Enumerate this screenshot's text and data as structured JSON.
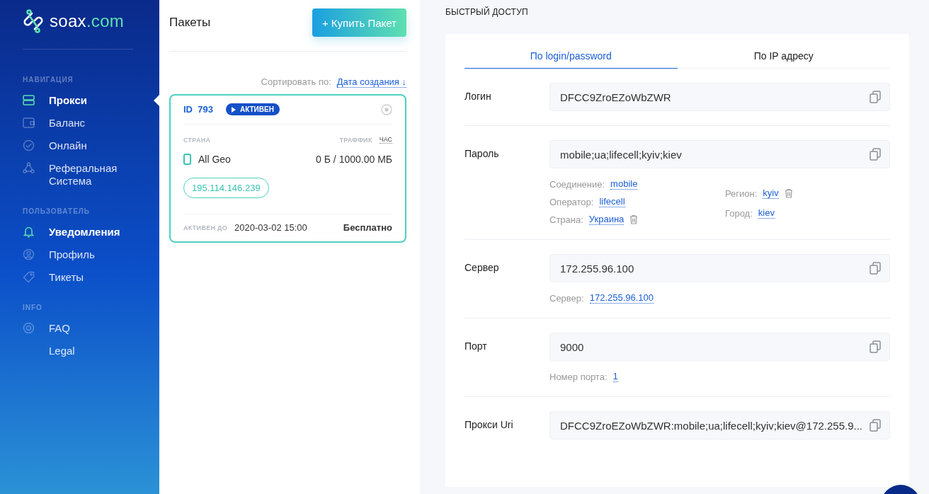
{
  "logo": {
    "name": "soax",
    "tld": ".com"
  },
  "sidebar": {
    "sections": [
      {
        "title": "НАВИГАЦИЯ",
        "items": [
          {
            "label": "Прокси",
            "selected": true,
            "highlighted": true
          },
          {
            "label": "Баланс",
            "selected": false,
            "highlighted": false
          },
          {
            "label": "Онлайн",
            "selected": false,
            "highlighted": false
          },
          {
            "label": "Реферальная Система",
            "selected": false,
            "highlighted": false
          }
        ]
      },
      {
        "title": "ПОЛЬЗОВАТЕЛЬ",
        "items": [
          {
            "label": "Уведомления",
            "selected": false,
            "highlighted": true
          },
          {
            "label": "Профиль",
            "selected": false,
            "highlighted": false
          },
          {
            "label": "Тикеты",
            "selected": false,
            "highlighted": false
          }
        ]
      },
      {
        "title": "INFO",
        "items": [
          {
            "label": "FAQ",
            "selected": false,
            "highlighted": false
          },
          {
            "label": "Legal",
            "selected": false,
            "highlighted": false
          }
        ]
      }
    ]
  },
  "packages": {
    "title": "Пакеты",
    "buy_button": "+ Купить Пакет",
    "sort_label": "Сортировать по:",
    "sort_value": "Дата создания ↓",
    "cards": [
      {
        "id_label": "ID",
        "id": "793",
        "status": "АКТИВЕН",
        "country_label": "СТРАНА",
        "traffic_label": "ТРАФФИК",
        "traffic_unit": "ЧАС",
        "country": "All Geo",
        "traffic": "0 Б / 1000.00 МБ",
        "ip": "195.114.146.239",
        "active_until_label": "АКТИВЕН ДО",
        "active_until": "2020-03-02 15:00",
        "price": "Бесплатно",
        "selected": true
      }
    ]
  },
  "quick_access": {
    "title": "БЫСТРЫЙ ДОСТУП",
    "tabs": [
      {
        "label": "По login/password",
        "selected": true
      },
      {
        "label": "По IP адресу",
        "selected": false
      }
    ],
    "rows": [
      {
        "label": "Логин",
        "value": "DFCC9ZroEZoWbZWR"
      },
      {
        "label": "Пароль",
        "value": "mobile;ua;lifecell;kyiv;kiev",
        "hint_columns": [
          [
            {
              "label": "Соединение:",
              "value": "mobile",
              "deletable": false
            },
            {
              "label": "Оператор:",
              "value": "lifecell",
              "deletable": false
            },
            {
              "label": "Страна:",
              "value": "Украина",
              "deletable": true
            }
          ],
          [
            {
              "label": "Регион:",
              "value": "kyiv",
              "deletable": true
            },
            {
              "label": "Город:",
              "value": "kiev",
              "deletable": false
            }
          ]
        ]
      },
      {
        "label": "Сервер",
        "value": "172.255.96.100",
        "hint_columns": [
          [
            {
              "label": "Сервер:",
              "value": "172.255.96.100",
              "deletable": false
            }
          ]
        ]
      },
      {
        "label": "Порт",
        "value": "9000",
        "hint_columns": [
          [
            {
              "label": "Номер порта:",
              "value": "1",
              "deletable": false
            }
          ]
        ]
      },
      {
        "label": "Прокси Uri",
        "value": "DFCC9ZroEZoWbZWR:mobile;ua;lifecell;kyiv;kiev@172.255.9..."
      }
    ]
  }
}
